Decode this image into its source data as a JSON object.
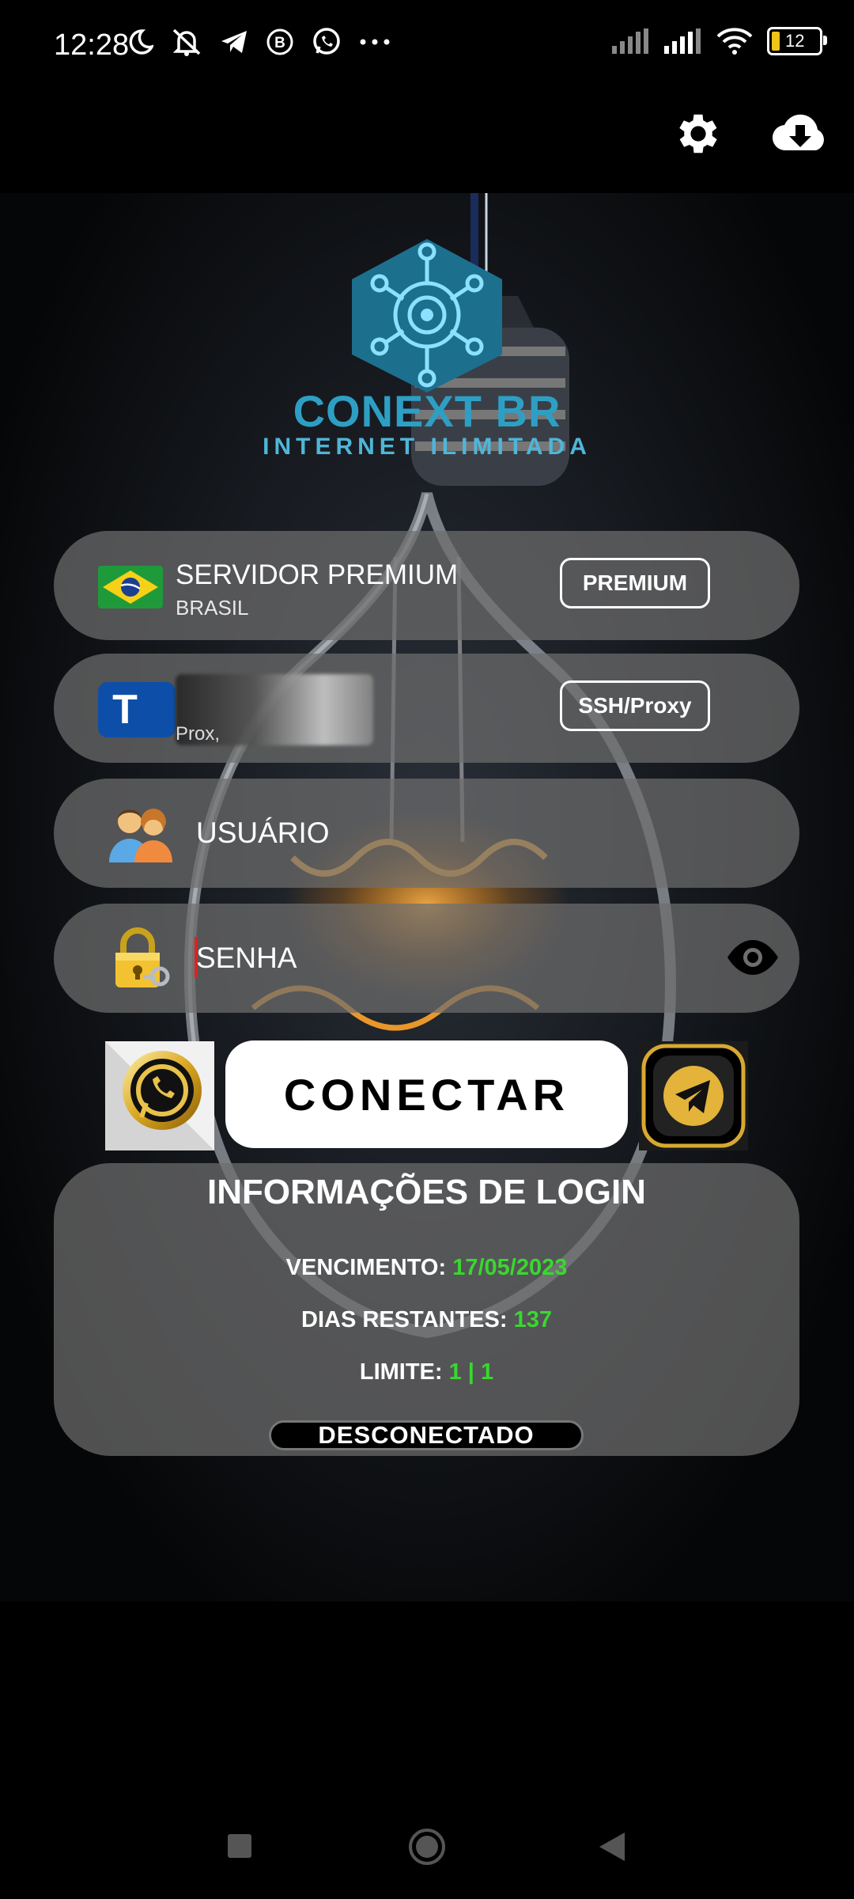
{
  "status_bar": {
    "time": "12:28",
    "battery_level": "12",
    "icons": [
      "moon-icon",
      "muted-bell-icon",
      "telegram-icon",
      "b-icon",
      "whatsapp-icon",
      "more-icon",
      "signal-icon",
      "signal-icon",
      "wifi-icon",
      "battery-icon"
    ]
  },
  "top_bar": {
    "icons": [
      "gear-icon",
      "cloud-download-icon"
    ]
  },
  "brand": {
    "name": "CONEXT BR",
    "tagline": "INTERNET ILIMITADA"
  },
  "server": {
    "title": "SERVIDOR PREMIUM",
    "subtitle": "BRASIL",
    "tag": "PREMIUM",
    "flag": "brazil-flag-icon"
  },
  "mode": {
    "icon_letter": "T",
    "subtitle": "Prox,",
    "tag": "SSH/Proxy"
  },
  "user_field": {
    "placeholder": "USUÁRIO"
  },
  "password_field": {
    "placeholder": "SENHA"
  },
  "connect_label": "CONECTAR",
  "login_info": {
    "title": "INFORMAÇÕES DE LOGIN",
    "expiry_label": "VENCIMENTO: ",
    "expiry_value": "17/05/2023",
    "days_label": "DIAS RESTANTES: ",
    "days_value": "137",
    "limit_label": "LIMITE: ",
    "limit_value": "1 | 1",
    "connection_status": "DESCONECTADO"
  },
  "colors": {
    "accent_green": "#39d82f",
    "brand_blue": "#2e9fc4",
    "panel": "#6e6e6e"
  }
}
